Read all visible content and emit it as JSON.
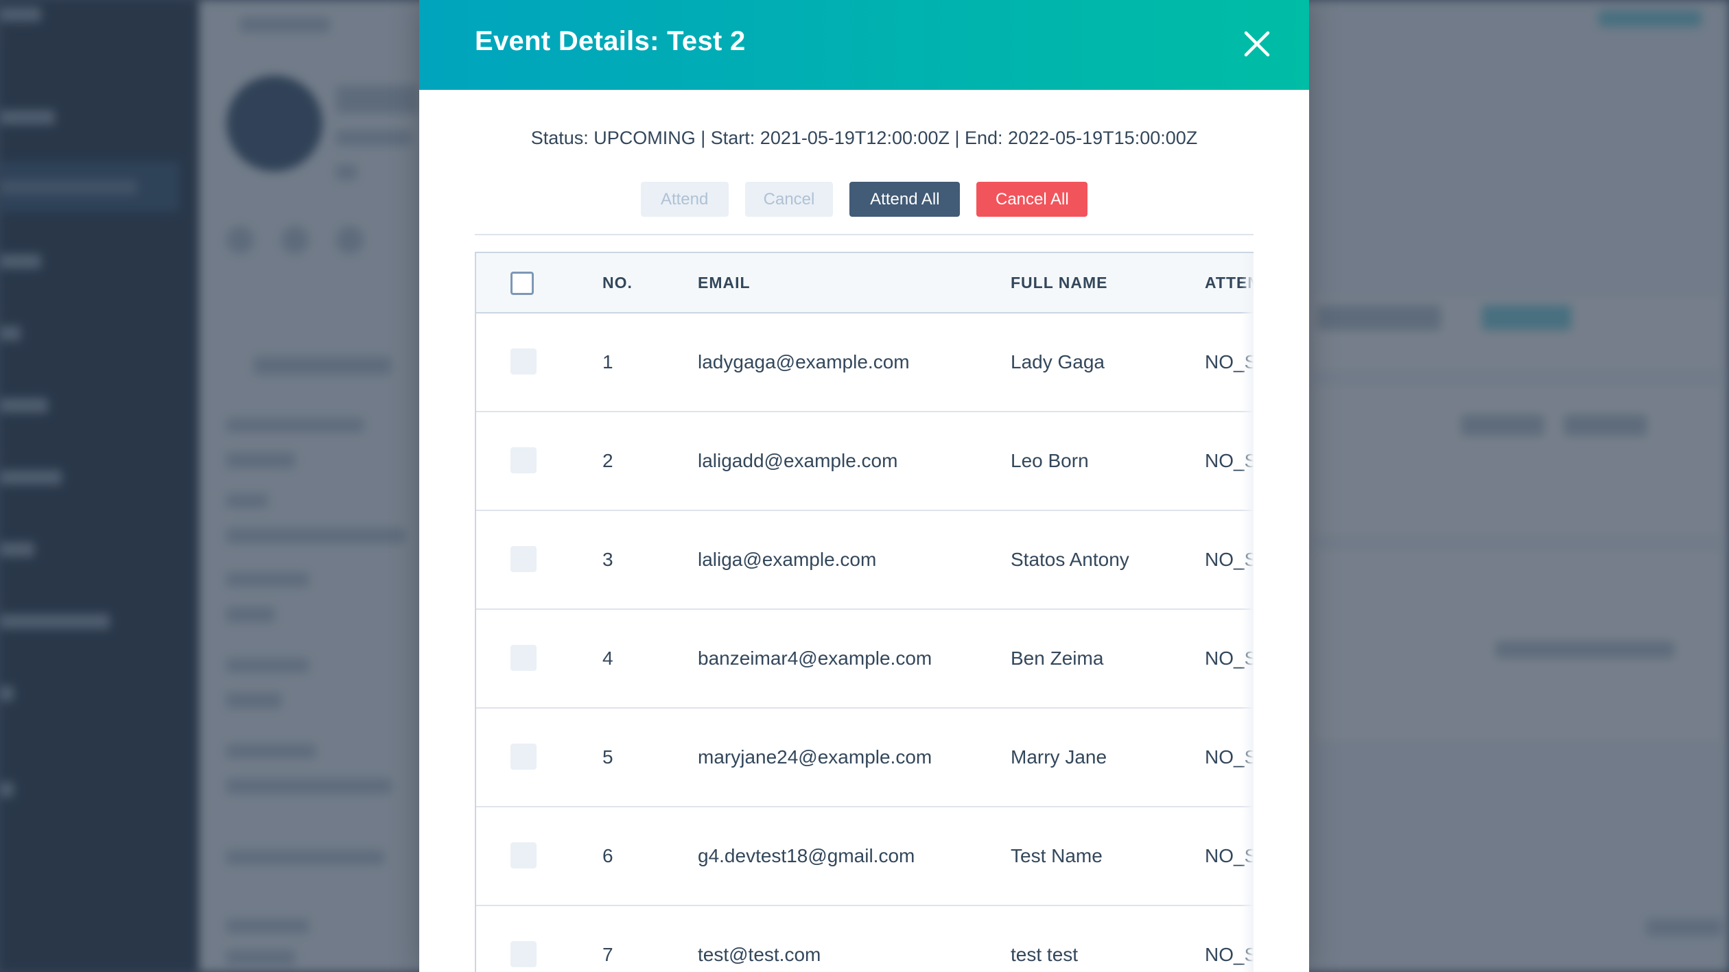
{
  "modal": {
    "title": "Event Details: Test 2",
    "status_line": "Status: UPCOMING | Start: 2021-05-19T12:00:00Z | End: 2022-05-19T15:00:00Z",
    "buttons": {
      "attend": "Attend",
      "cancel": "Cancel",
      "attend_all": "Attend All",
      "cancel_all": "Cancel All"
    },
    "close_icon": "close-icon"
  },
  "table": {
    "headers": {
      "no": "NO.",
      "email": "EMAIL",
      "full_name": "FULL NAME",
      "attendance": "ATTEN"
    },
    "rows": [
      {
        "no": "1",
        "email": "ladygaga@example.com",
        "name": "Lady Gaga",
        "attendance": "NO_S"
      },
      {
        "no": "2",
        "email": "laligadd@example.com",
        "name": "Leo Born",
        "attendance": "NO_S"
      },
      {
        "no": "3",
        "email": "laliga@example.com",
        "name": "Statos Antony",
        "attendance": "NO_S"
      },
      {
        "no": "4",
        "email": "banzeimar4@example.com",
        "name": "Ben Zeima",
        "attendance": "NO_S"
      },
      {
        "no": "5",
        "email": "maryjane24@example.com",
        "name": "Marry Jane",
        "attendance": "NO_S"
      },
      {
        "no": "6",
        "email": "g4.devtest18@gmail.com",
        "name": "Test Name",
        "attendance": "NO_S"
      },
      {
        "no": "7",
        "email": "test@test.com",
        "name": "test test",
        "attendance": "NO_S"
      }
    ]
  },
  "colors": {
    "header_gradient_start": "#00a4bd",
    "header_gradient_end": "#00bda5",
    "dark_button": "#425b76",
    "danger_button": "#f2545b",
    "text": "#33475b"
  }
}
